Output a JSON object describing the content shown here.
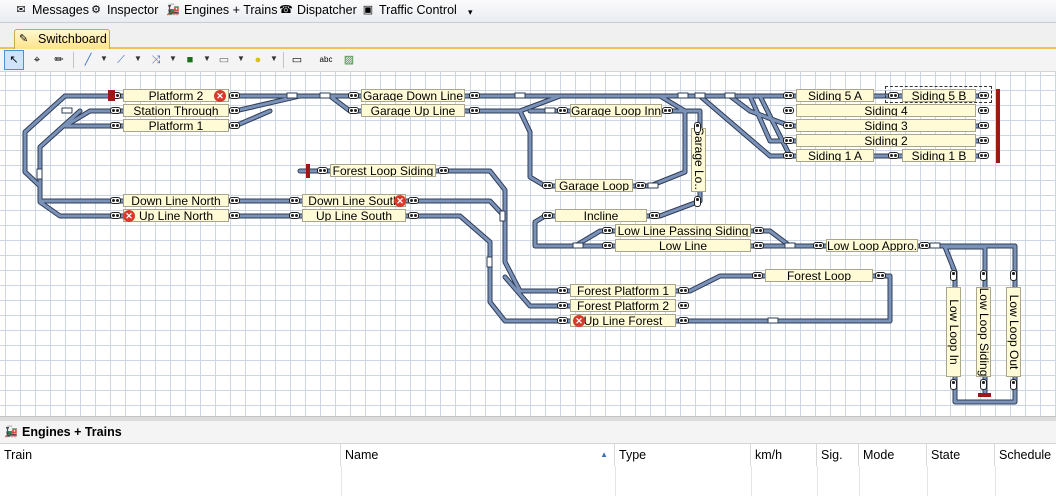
{
  "menubar": {
    "items": [
      {
        "label": "Messages",
        "icon": "messages-icon"
      },
      {
        "label": "Inspector",
        "icon": "inspector-icon"
      },
      {
        "label": "Engines + Trains",
        "icon": "engines-icon"
      },
      {
        "label": "Dispatcher",
        "icon": "dispatcher-icon"
      },
      {
        "label": "Traffic Control",
        "icon": "traffic-control-icon"
      }
    ]
  },
  "tab": {
    "label": "Switchboard",
    "icon": "switchboard-icon"
  },
  "blocks": {
    "platform_2": "Platform 2",
    "station_through": "Station Through",
    "platform_1": "Platform 1",
    "garage_down_line": "Garage Down Line",
    "garage_up_line": "Garage Up Line",
    "garage_loop_inner": "Garage Loop Inner",
    "garage_lo": "Garage Lo...",
    "siding_5a": "Siding 5 A",
    "siding_5b": "Siding 5 B",
    "siding_4": "Siding 4",
    "siding_3": "Siding 3",
    "siding_2": "Siding 2",
    "siding_1a": "Siding 1 A",
    "siding_1b": "Siding 1 B",
    "forest_loop_siding": "Forest Loop Siding",
    "garage_loop": "Garage Loop",
    "down_line_north": "Down Line North",
    "up_line_north": "Up Line North",
    "down_line_south": "Down Line South",
    "up_line_south": "Up Line South",
    "incline": "Incline",
    "low_line_passing_siding": "Low Line Passing Siding",
    "low_line": "Low Line",
    "low_loop_appro": "Low Loop Appro...",
    "forest_loop": "Forest Loop",
    "forest_platform_1": "Forest Platform 1",
    "forest_platform_2": "Forest Platform 2",
    "up_line_forest": "Up Line Forest",
    "low_loop_in": "Low Loop In",
    "low_loop_siding": "Low Loop Siding",
    "low_loop_out": "Low Loop Out"
  },
  "panel": {
    "title": "Engines + Trains"
  },
  "table": {
    "columns": [
      "Train",
      "Name",
      "Type",
      "km/h",
      "Sig.",
      "Mode",
      "State",
      "Schedule"
    ],
    "sorted_column": "Name"
  },
  "colors": {
    "track": "#5b7397",
    "track_edge": "#2e3c56",
    "block_fill": "#fffbd6",
    "stop_red": "#d8392b",
    "buffer": "#a01717",
    "tab_accent": "#f0c24f"
  }
}
